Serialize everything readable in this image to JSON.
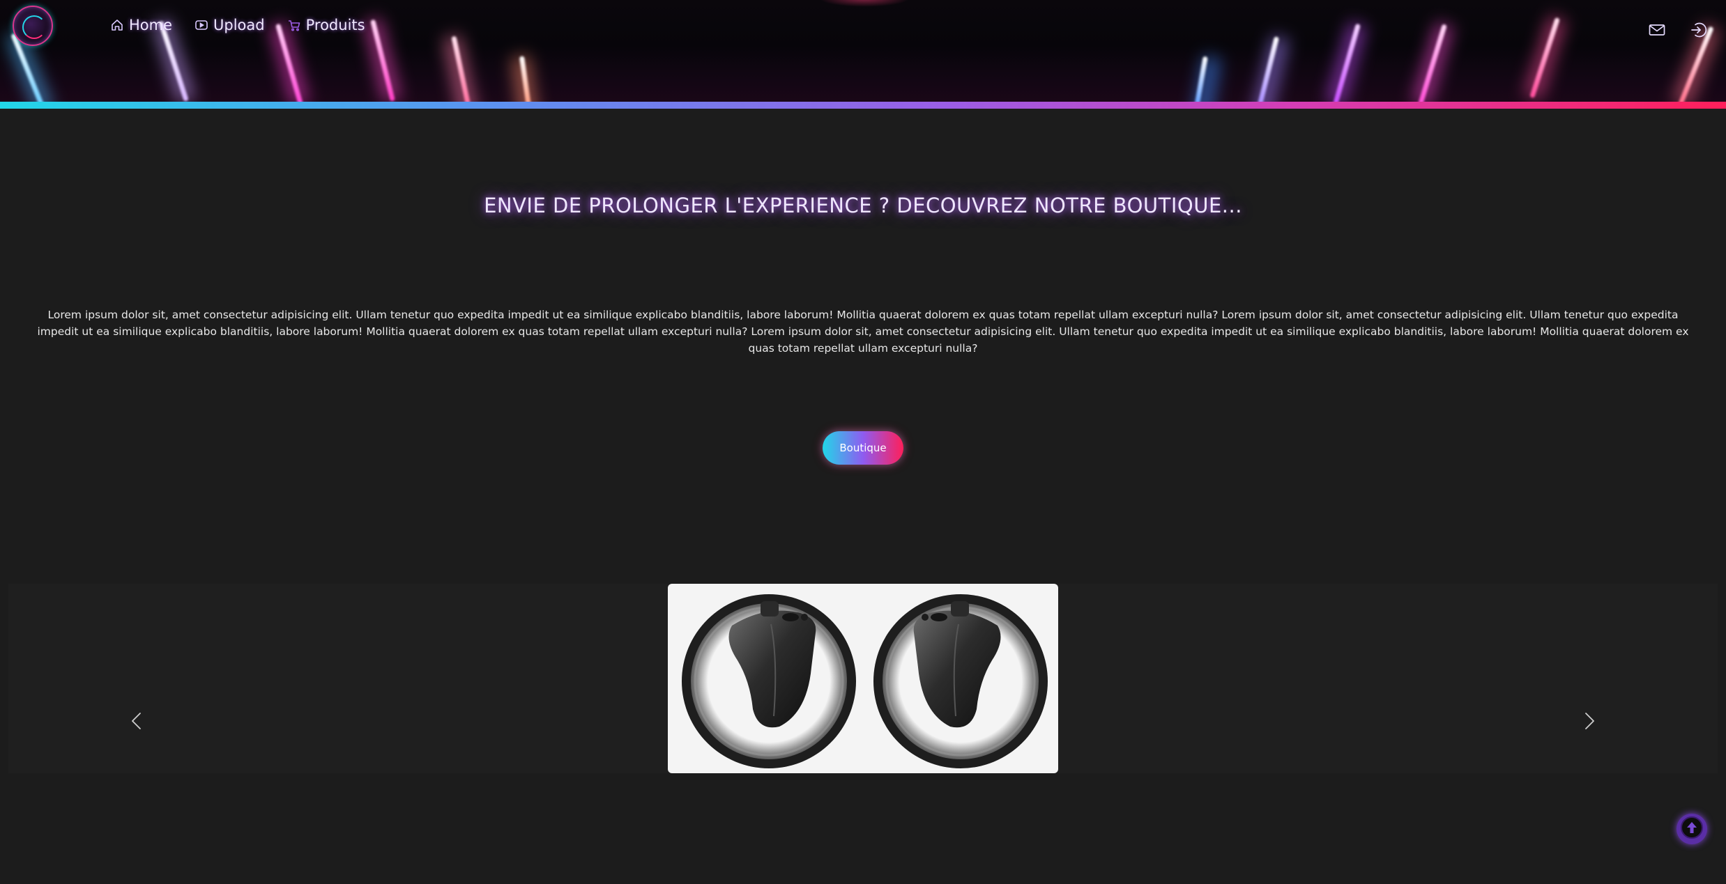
{
  "header": {
    "nav": [
      {
        "label": "Home",
        "icon": "home-icon"
      },
      {
        "label": "Upload",
        "icon": "play-icon"
      },
      {
        "label": "Produits",
        "icon": "cart-icon"
      }
    ],
    "right_icons": [
      "mail-icon",
      "login-icon"
    ]
  },
  "main": {
    "title": "ENVIE DE PROLONGER L'EXPERIENCE ? DECOUVREZ NOTRE BOUTIQUE...",
    "paragraph": "Lorem ipsum dolor sit, amet consectetur adipisicing elit. Ullam tenetur quo expedita impedit ut ea similique explicabo blanditiis, labore laborum! Mollitia quaerat dolorem ex quas totam repellat ullam excepturi nulla? Lorem ipsum dolor sit, amet consectetur adipisicing elit. Ullam tenetur quo expedita impedit ut ea similique explicabo blanditiis, labore laborum! Mollitia quaerat dolorem ex quas totam repellat ullam excepturi nulla? Lorem ipsum dolor sit, amet consectetur adipisicing elit. Ullam tenetur quo expedita impedit ut ea similique explicabo blanditiis, labore laborum! Mollitia quaerat dolorem ex quas totam repellat ullam excepturi nulla?",
    "cta_label": "Boutique"
  },
  "carousel": {
    "prev_icon": "chevron-left-icon",
    "next_icon": "chevron-right-icon",
    "slide_image": "vr-controllers-image"
  },
  "scroll_top_icon": "arrow-up-circle-icon",
  "colors": {
    "background": "#1c1c1c",
    "accent_cyan": "#22d6e8",
    "accent_purple": "#9b5de5",
    "accent_pink": "#ff1f5a"
  }
}
